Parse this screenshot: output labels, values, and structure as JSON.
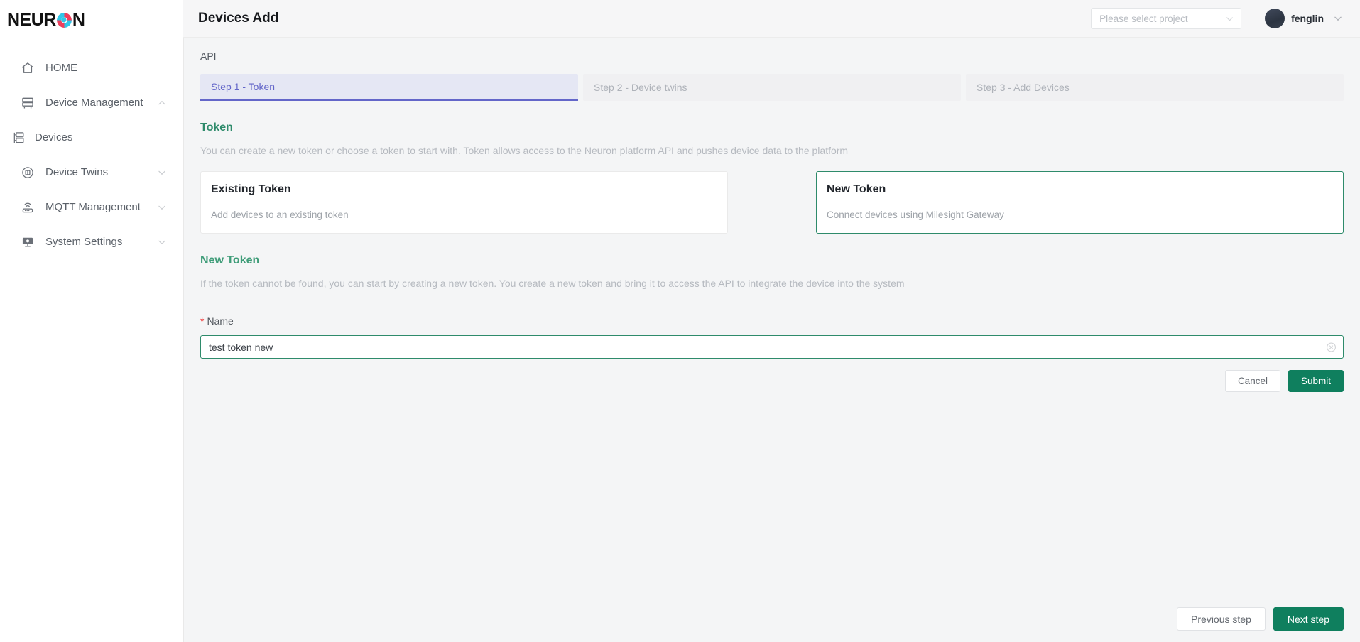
{
  "brand": {
    "logo_prefix": "NEUR",
    "logo_suffix": "N",
    "logo_mark_colors": [
      "#ef3e5c",
      "#30c6e8"
    ]
  },
  "sidebar": {
    "items": [
      {
        "label": "HOME",
        "icon": "home-icon",
        "expandable": false,
        "sub": false
      },
      {
        "label": "Device Management",
        "icon": "server-icon",
        "expandable": true,
        "chevron": "chevron-up-icon",
        "sub": false
      },
      {
        "label": "Devices",
        "icon": "devices-icon",
        "expandable": false,
        "sub": true
      },
      {
        "label": "Device Twins",
        "icon": "twin-icon",
        "expandable": true,
        "chevron": "chevron-down-icon",
        "sub": false
      },
      {
        "label": "MQTT Management",
        "icon": "router-icon",
        "expandable": true,
        "chevron": "chevron-down-icon",
        "sub": false
      },
      {
        "label": "System Settings",
        "icon": "monitor-icon",
        "expandable": true,
        "chevron": "chevron-down-icon",
        "sub": false
      }
    ]
  },
  "topbar": {
    "title": "Devices Add",
    "project_select": {
      "placeholder": "Please select project",
      "value": "",
      "chevron": "chevron-down-icon"
    },
    "user": {
      "name": "fenglin",
      "avatar": "avatar",
      "chevron": "chevron-down-icon"
    }
  },
  "main": {
    "api_label": "API",
    "steps": [
      {
        "label": "Step 1 - Token",
        "active": true
      },
      {
        "label": "Step 2 - Device twins",
        "active": false
      },
      {
        "label": "Step 3 - Add Devices",
        "active": false
      }
    ],
    "token_section": {
      "title": "Token",
      "description": "You can create a new token or choose a token to start with. Token allows access to the Neuron platform API and pushes device data to the platform",
      "cards": [
        {
          "title": "Existing Token",
          "subtitle": "Add devices to an existing token",
          "selected": false
        },
        {
          "title": "New Token",
          "subtitle": "Connect devices using Milesight Gateway",
          "selected": true
        }
      ]
    },
    "new_token_section": {
      "title": "New Token",
      "description": "If the token cannot be found, you can start by creating a new token. You create a new token and bring it to access the API to integrate the device into the system",
      "name_field": {
        "label": "Name",
        "required_marker": "*",
        "value": "test token new",
        "placeholder": "",
        "clear_icon": "clear-circle-icon"
      },
      "cancel_label": "Cancel",
      "submit_label": "Submit"
    },
    "footer": {
      "previous_label": "Previous step",
      "next_label": "Next step"
    }
  },
  "colors": {
    "accent_green": "#0f7f5e",
    "section_green": "#2e8b6b",
    "active_step_purple": "#6366c9",
    "active_step_bg": "#e5e7f4",
    "required_red": "#f04b4b",
    "page_bg": "#f4f5f6"
  }
}
